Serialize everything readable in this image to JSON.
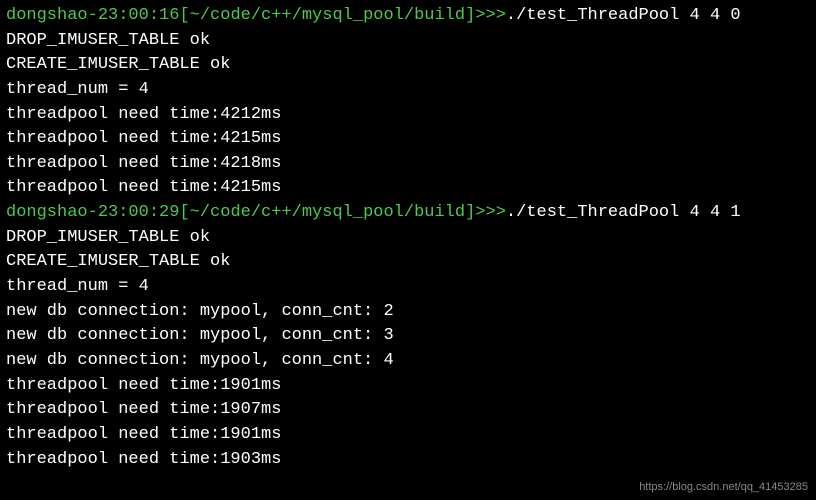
{
  "terminal": {
    "lines": [
      {
        "type": "prompt",
        "user": "dongshao-23:00:16",
        "path": "[~/code/c++/mysql_pool/build]",
        "arrow": ">>>",
        "command": "./test_ThreadPool 4 4 0"
      },
      {
        "type": "output",
        "text": "DROP_IMUSER_TABLE ok"
      },
      {
        "type": "output",
        "text": "CREATE_IMUSER_TABLE ok"
      },
      {
        "type": "output",
        "text": "thread_num = 4"
      },
      {
        "type": "output",
        "text": "threadpool need time:4212ms"
      },
      {
        "type": "output",
        "text": "threadpool need time:4215ms"
      },
      {
        "type": "output",
        "text": "threadpool need time:4218ms"
      },
      {
        "type": "output",
        "text": "threadpool need time:4215ms"
      },
      {
        "type": "prompt",
        "user": "dongshao-23:00:29",
        "path": "[~/code/c++/mysql_pool/build]",
        "arrow": ">>>",
        "command": "./test_ThreadPool 4 4 1"
      },
      {
        "type": "output",
        "text": "DROP_IMUSER_TABLE ok"
      },
      {
        "type": "output",
        "text": "CREATE_IMUSER_TABLE ok"
      },
      {
        "type": "output",
        "text": "thread_num = 4"
      },
      {
        "type": "output",
        "text": "new db connection: mypool, conn_cnt: 2"
      },
      {
        "type": "output",
        "text": "new db connection: mypool, conn_cnt: 3"
      },
      {
        "type": "output",
        "text": "new db connection: mypool, conn_cnt: 4"
      },
      {
        "type": "output",
        "text": "threadpool need time:1901ms"
      },
      {
        "type": "output",
        "text": "threadpool need time:1907ms"
      },
      {
        "type": "output",
        "text": "threadpool need time:1901ms"
      },
      {
        "type": "output",
        "text": "threadpool need time:1903ms"
      }
    ]
  },
  "watermark": "https://blog.csdn.net/qq_41453285"
}
